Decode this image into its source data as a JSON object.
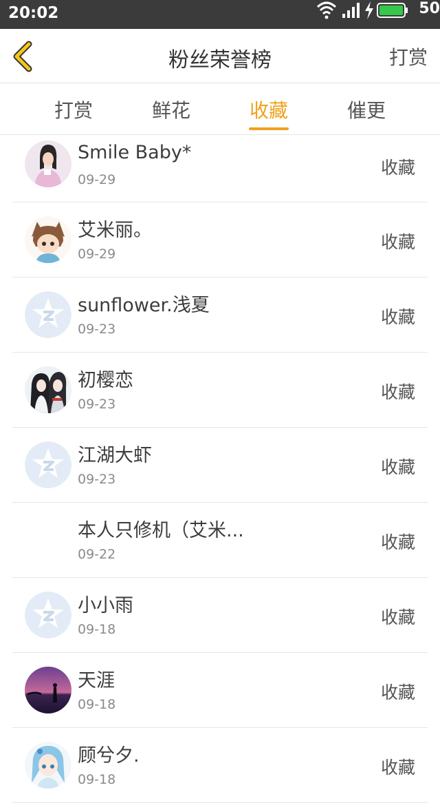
{
  "status_bar": {
    "time": "20:02",
    "battery_level": "50",
    "icons": [
      "wifi-icon",
      "signal-icon",
      "charging-icon",
      "battery-icon"
    ]
  },
  "header": {
    "back_icon": "chevron-left-icon",
    "title": "粉丝荣誉榜",
    "action_label": "打赏"
  },
  "tabs": [
    {
      "label": "打赏",
      "active": false
    },
    {
      "label": "鲜花",
      "active": false
    },
    {
      "label": "收藏",
      "active": true
    },
    {
      "label": "催更",
      "active": false
    }
  ],
  "colors": {
    "accent": "#f0a21e",
    "status_bar_bg": "#3b3b3b",
    "default_avatar_bg": "#e3ecf6"
  },
  "list": [
    {
      "name": "Smile Baby*",
      "date": "09-29",
      "action": "收藏",
      "avatar": "photo-girl"
    },
    {
      "name": "艾米丽。",
      "date": "09-29",
      "action": "收藏",
      "avatar": "cartoon-cat-girl"
    },
    {
      "name": "sunflower.浅夏",
      "date": "09-23",
      "action": "收藏",
      "avatar": "default"
    },
    {
      "name": "初樱恋",
      "date": "09-23",
      "action": "收藏",
      "avatar": "anime-couple"
    },
    {
      "name": "江湖大虾",
      "date": "09-23",
      "action": "收藏",
      "avatar": "default"
    },
    {
      "name": "本人只修机（艾米...",
      "date": "09-22",
      "action": "收藏",
      "avatar": "none"
    },
    {
      "name": "小小雨",
      "date": "09-18",
      "action": "收藏",
      "avatar": "default"
    },
    {
      "name": "天涯",
      "date": "09-18",
      "action": "收藏",
      "avatar": "sunset"
    },
    {
      "name": "顾兮夕.",
      "date": "09-18",
      "action": "收藏",
      "avatar": "anime-blue-hair"
    }
  ]
}
